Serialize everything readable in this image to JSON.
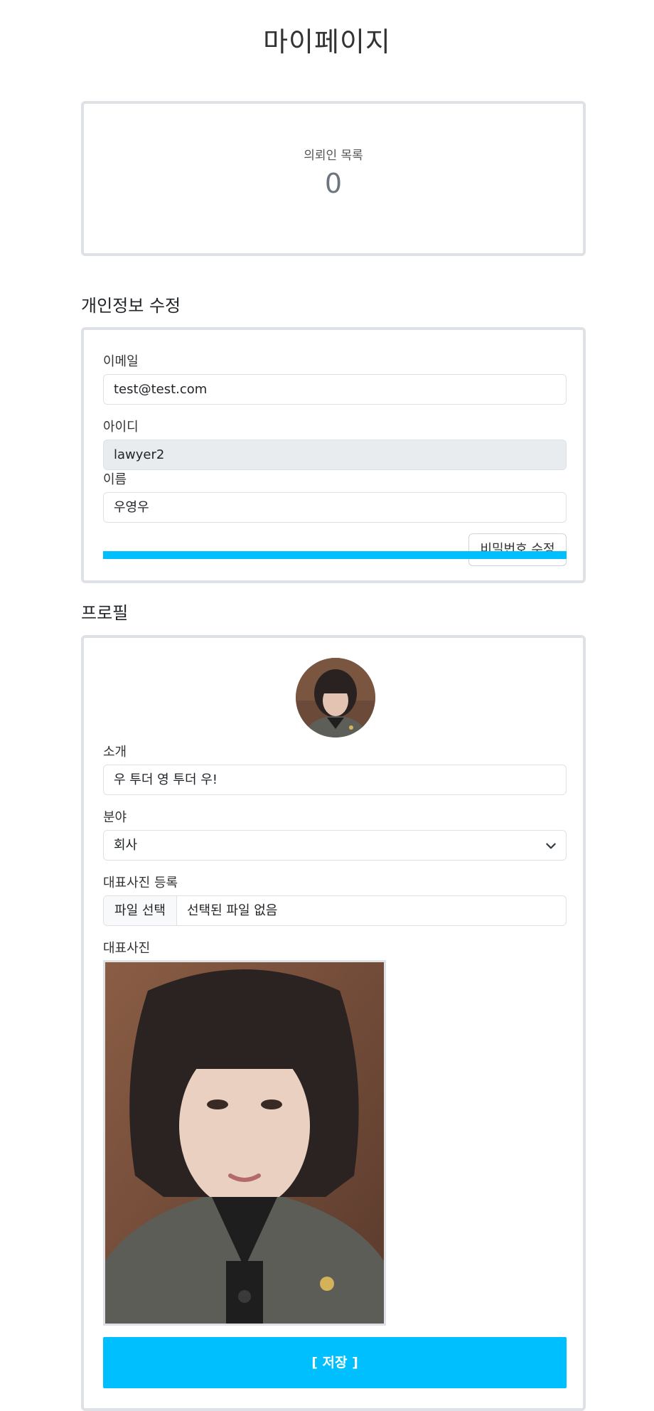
{
  "page": {
    "title": "마이페이지"
  },
  "clients": {
    "label": "의뢰인 목록",
    "count": "0"
  },
  "personal_info": {
    "heading": "개인정보 수정",
    "email": {
      "label": "이메일",
      "value": "test@test.com"
    },
    "user_id": {
      "label": "아이디",
      "value": "lawyer2"
    },
    "name": {
      "label": "이름",
      "value": "우영우"
    },
    "password_button": "비밀번호 수정"
  },
  "profile": {
    "heading": "프로필",
    "intro": {
      "label": "소개",
      "value": "우 투더 영 투더 우!"
    },
    "field": {
      "label": "분야",
      "value": "회사"
    },
    "photo_upload": {
      "label": "대표사진 등록",
      "button": "파일 선택",
      "status": "선택된 파일 없음"
    },
    "photo": {
      "label": "대표사진"
    },
    "save_button": "[ 저장 ]"
  },
  "colors": {
    "accent": "#00bfff",
    "border": "#dee2e6",
    "readonly_bg": "#e9ecef"
  },
  "icons": {
    "select": "chevron-down-icon"
  }
}
